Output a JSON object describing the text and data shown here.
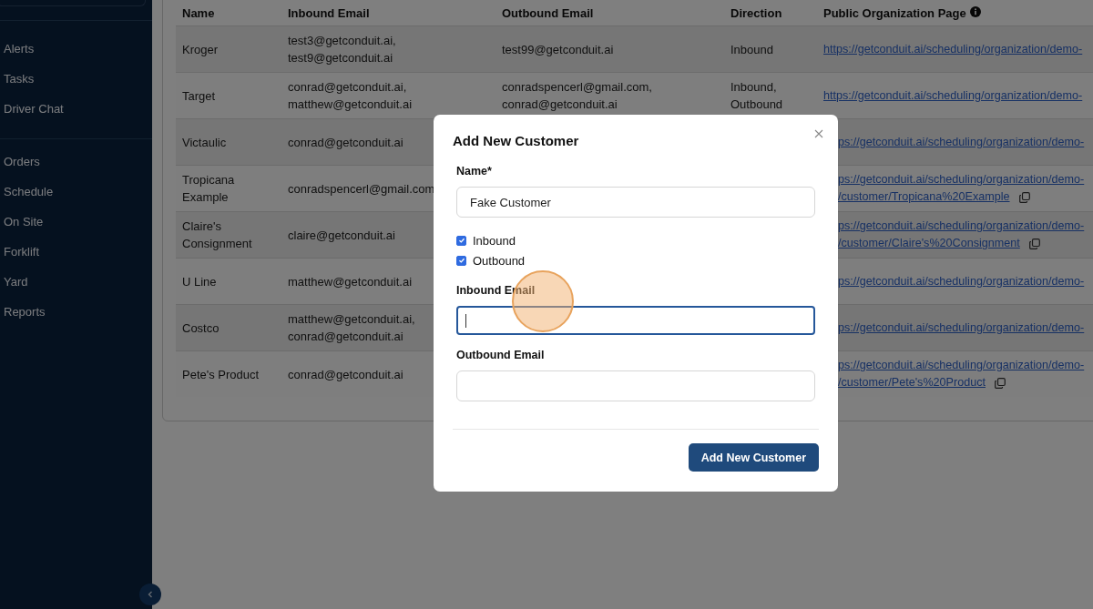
{
  "sidebar": {
    "groups": [
      {
        "items": [
          {
            "label": "Alerts"
          },
          {
            "label": "Tasks"
          },
          {
            "label": "Driver Chat"
          }
        ]
      },
      {
        "items": [
          {
            "label": "Orders"
          },
          {
            "label": "Schedule"
          },
          {
            "label": "On Site"
          },
          {
            "label": "Forklift"
          },
          {
            "label": "Yard"
          },
          {
            "label": "Reports"
          }
        ]
      }
    ]
  },
  "table": {
    "columns": [
      "Name",
      "Inbound Email",
      "Outbound Email",
      "Direction",
      "Public Organization Page"
    ],
    "rows": [
      {
        "name": [
          "Kroger"
        ],
        "inbound": [
          "test3@getconduit.ai,",
          "test9@getconduit.ai"
        ],
        "outbound": [
          "test99@getconduit.ai"
        ],
        "direction": [
          "Inbound"
        ],
        "link": [
          "https://getconduit.ai/scheduling/organization/demo-"
        ]
      },
      {
        "name": [
          "Target"
        ],
        "inbound": [
          "conrad@getconduit.ai,",
          "matthew@getconduit.ai"
        ],
        "outbound": [
          "conradspencerl@gmail.com,",
          "conrad@getconduit.ai"
        ],
        "direction": [
          "Inbound,",
          "Outbound"
        ],
        "link": [
          "https://getconduit.ai/scheduling/organization/demo-"
        ]
      },
      {
        "name": [
          "Victaulic"
        ],
        "inbound": [
          "conrad@getconduit.ai"
        ],
        "link": [
          "ps://getconduit.ai/scheduling/organization/demo-"
        ]
      },
      {
        "name": [
          "Tropicana",
          "Example"
        ],
        "inbound": [
          "conradspencerl@gmail.com"
        ],
        "link": [
          "ps://getconduit.ai/scheduling/organization/demo-",
          "/customer/Tropicana%20Example"
        ]
      },
      {
        "name": [
          "Claire's",
          "Consignment"
        ],
        "inbound": [
          "claire@getconduit.ai"
        ],
        "link": [
          "ps://getconduit.ai/scheduling/organization/demo-",
          "/customer/Claire's%20Consignment"
        ]
      },
      {
        "name": [
          "U Line"
        ],
        "inbound": [
          "matthew@getconduit.ai"
        ],
        "link": [
          "ps://getconduit.ai/scheduling/organization/demo-"
        ]
      },
      {
        "name": [
          "Costco"
        ],
        "inbound": [
          "matthew@getconduit.ai,",
          "conrad@getconduit.ai"
        ],
        "link": [
          "ps://getconduit.ai/scheduling/organization/demo-"
        ]
      },
      {
        "name": [
          "Pete's Product"
        ],
        "inbound": [
          "conrad@getconduit.ai"
        ],
        "link": [
          "ps://getconduit.ai/scheduling/organization/demo-",
          "/customer/Pete's%20Product"
        ]
      }
    ]
  },
  "modal": {
    "title": "Add New Customer",
    "name_field": {
      "label": "Name*",
      "value": "Fake Customer",
      "focused": false
    },
    "checkboxes": [
      {
        "label": "Inbound",
        "checked": true
      },
      {
        "label": "Outbound",
        "checked": true
      }
    ],
    "email_fields": [
      {
        "label": "Inbound Email",
        "focused": true
      },
      {
        "label": "Outbound Email",
        "focused": false
      }
    ],
    "submit": "Add New Customer"
  }
}
